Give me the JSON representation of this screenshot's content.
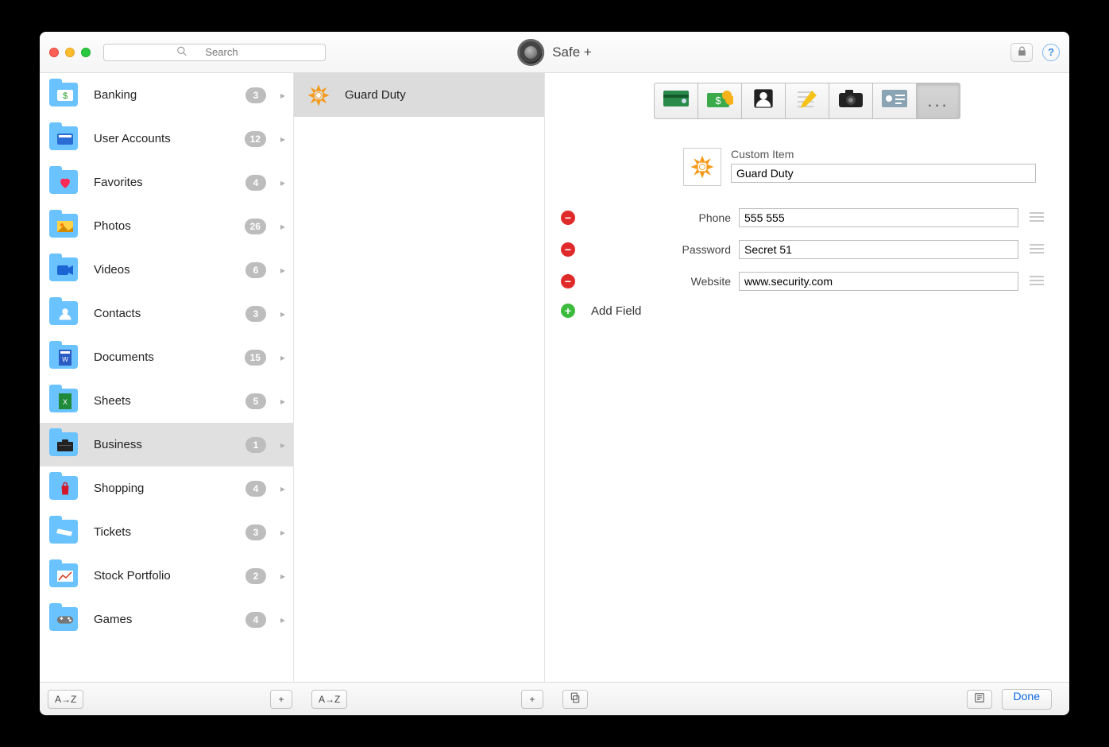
{
  "app_title": "Safe +",
  "search_placeholder": "Search",
  "lock_button_label": "Lock",
  "help_button_label": "Help",
  "done_label": "Done",
  "sort_label": "A→Z",
  "add_label": "+",
  "sidebar": {
    "items": [
      {
        "label": "Banking",
        "count": "3",
        "icon": "banking",
        "selected": false
      },
      {
        "label": "User Accounts",
        "count": "12",
        "icon": "accounts",
        "selected": false
      },
      {
        "label": "Favorites",
        "count": "4",
        "icon": "heart",
        "selected": false
      },
      {
        "label": "Photos",
        "count": "26",
        "icon": "photos",
        "selected": false
      },
      {
        "label": "Videos",
        "count": "6",
        "icon": "video",
        "selected": false
      },
      {
        "label": "Contacts",
        "count": "3",
        "icon": "contact",
        "selected": false
      },
      {
        "label": "Documents",
        "count": "15",
        "icon": "document",
        "selected": false
      },
      {
        "label": "Sheets",
        "count": "5",
        "icon": "sheet",
        "selected": false
      },
      {
        "label": "Business",
        "count": "1",
        "icon": "business",
        "selected": true
      },
      {
        "label": "Shopping",
        "count": "4",
        "icon": "shopping",
        "selected": false
      },
      {
        "label": "Tickets",
        "count": "3",
        "icon": "ticket",
        "selected": false
      },
      {
        "label": "Stock Portfolio",
        "count": "2",
        "icon": "stock",
        "selected": false
      },
      {
        "label": "Games",
        "count": "4",
        "icon": "games",
        "selected": false
      }
    ]
  },
  "middle": {
    "items": [
      {
        "label": "Guard Duty",
        "icon": "asterisk",
        "selected": true
      }
    ]
  },
  "type_toolbar": {
    "items": [
      {
        "name": "credit-card",
        "selected": false
      },
      {
        "name": "cash",
        "selected": false
      },
      {
        "name": "contact",
        "selected": false
      },
      {
        "name": "note",
        "selected": false
      },
      {
        "name": "photo",
        "selected": false
      },
      {
        "name": "id-card",
        "selected": false
      },
      {
        "name": "more",
        "selected": true
      }
    ]
  },
  "detail": {
    "type_label": "Custom Item",
    "name": "Guard Duty",
    "add_field_label": "Add Field",
    "fields": [
      {
        "label": "Phone",
        "value": "555 555"
      },
      {
        "label": "Password",
        "value": "Secret 51"
      },
      {
        "label": "Website",
        "value": "www.security.com"
      }
    ]
  }
}
